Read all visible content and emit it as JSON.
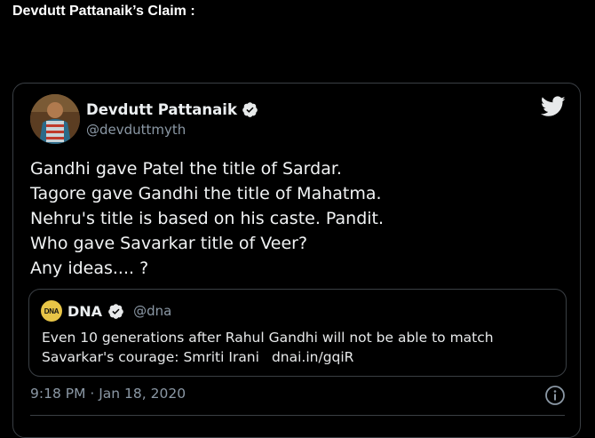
{
  "page": {
    "heading": "Devdutt Pattanaik’s Claim :"
  },
  "tweet": {
    "author_name": "Devdutt Pattanaik",
    "author_handle": "@devduttmyth",
    "text_lines": [
      "Gandhi gave Patel the title of Sardar.",
      "Tagore gave Gandhi the title of Mahatma.",
      "Nehru's title is based on his caste. Pandit.",
      "Who gave Savarkar title of Veer?",
      "Any ideas.... ?"
    ],
    "timestamp": "9:18 PM · Jan 18, 2020",
    "quoted": {
      "logo_text": "DNA",
      "name": "DNA",
      "handle": "@dna",
      "text_line_1": "Even 10 generations after Rahul Gandhi will not be able to match",
      "text_line_2": "Savarkar's courage: Smriti Irani",
      "link": "dnai.in/gqiR"
    }
  },
  "icons": {
    "verified": "verified-badge-icon",
    "twitter": "twitter-bird-icon",
    "info": "info-icon"
  },
  "colors": {
    "background": "#000000",
    "text": "#e7e9ea",
    "muted": "#8b98a5",
    "border": "#3a3f44",
    "dna_logo": "#e8c547"
  }
}
